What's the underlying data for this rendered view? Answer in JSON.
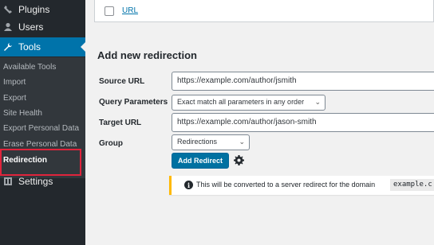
{
  "sidebar": {
    "menu": [
      {
        "label": "Plugins",
        "icon": "plugin-icon"
      },
      {
        "label": "Users",
        "icon": "users-icon"
      },
      {
        "label": "Tools",
        "icon": "wrench-icon",
        "active": true
      },
      {
        "label": "Settings",
        "icon": "settings-icon"
      }
    ],
    "submenu": [
      "Available Tools",
      "Import",
      "Export",
      "Site Health",
      "Export Personal Data",
      "Erase Personal Data",
      "Redirection"
    ]
  },
  "top_panel": {
    "link_label": "URL"
  },
  "form": {
    "title": "Add new redirection",
    "source_label": "Source URL",
    "source_value": "https://example.com/author/jsmith",
    "query_label": "Query Parameters",
    "query_value": "Exact match all parameters in any order",
    "target_label": "Target URL",
    "target_value": "https://example.com/author/jason-smith",
    "group_label": "Group",
    "group_value": "Redirections",
    "submit_label": "Add Redirect"
  },
  "notice": {
    "message": "This will be converted to a server redirect for the domain",
    "domain": "example.c"
  },
  "colors": {
    "sidebar_bg": "#23282d",
    "submenu_bg": "#32373c",
    "accent": "#0073aa",
    "highlight": "#e0243c",
    "notice_border": "#ffb900"
  }
}
